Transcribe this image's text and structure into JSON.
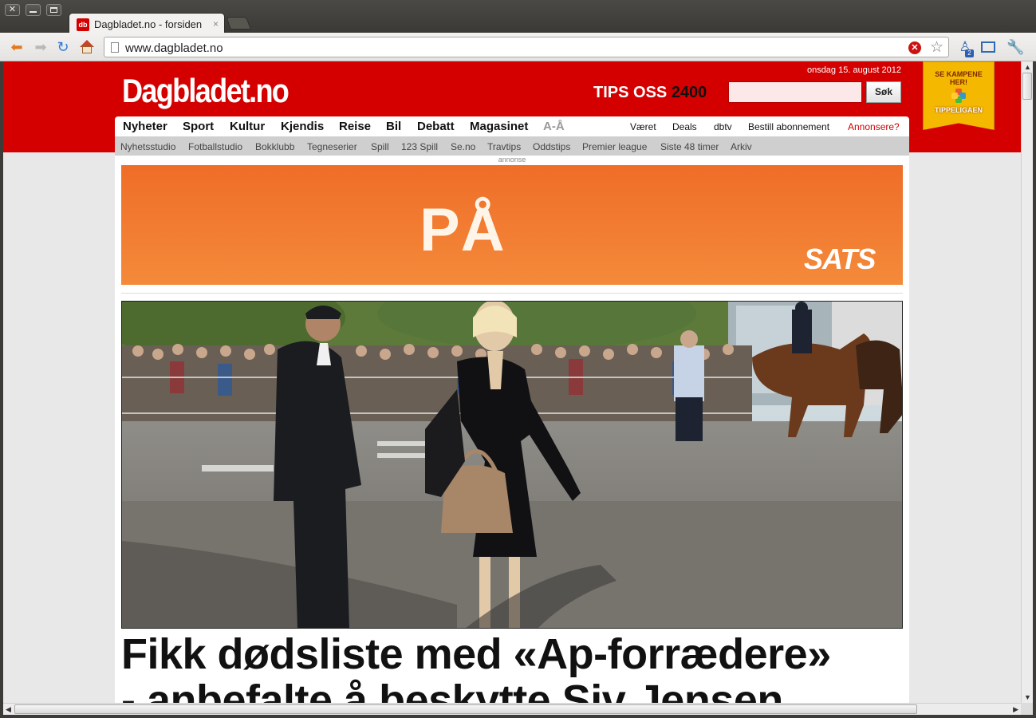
{
  "browser": {
    "tab_title": "Dagbladet.no - forsiden",
    "tab_favicon": "db",
    "tab_close": "×",
    "url": "www.dagbladet.no",
    "ext_badge": "2"
  },
  "site": {
    "logo": "Dagbladet.no",
    "date": "onsdag 15. august 2012",
    "tips_label": "TIPS OSS",
    "tips_number": "2400",
    "search_placeholder": "",
    "search_button": "Søk",
    "brand_color": "#d40000"
  },
  "nav": {
    "main": [
      "Nyheter",
      "Sport",
      "Kultur",
      "Kjendis",
      "Reise",
      "Bil",
      "Debatt",
      "Magasinet",
      "A-Å"
    ],
    "right": [
      "Været",
      "Deals",
      "dbtv",
      "Bestill abonnement",
      "Annonsere?"
    ]
  },
  "subnav": [
    "Nyhetsstudio",
    "Fotballstudio",
    "Bokklubb",
    "Tegneserier",
    "Spill",
    "123 Spill",
    "Se.no",
    "Travtips",
    "Oddstips",
    "Premier league",
    "Siste 48 timer",
    "Arkiv"
  ],
  "tippeligaen": {
    "line1": "SE KAMPENE",
    "line2": "HER!",
    "name": "TIPPELIGAEN"
  },
  "ad": {
    "label": "annonse",
    "text": "PÅ",
    "brand": "SATS",
    "color": "#ef6d28"
  },
  "article": {
    "headline_line1": "Fikk dødsliste med «Ap-forrædere»",
    "headline_line2": "- anbefalte å beskytte Siv Jensen"
  }
}
